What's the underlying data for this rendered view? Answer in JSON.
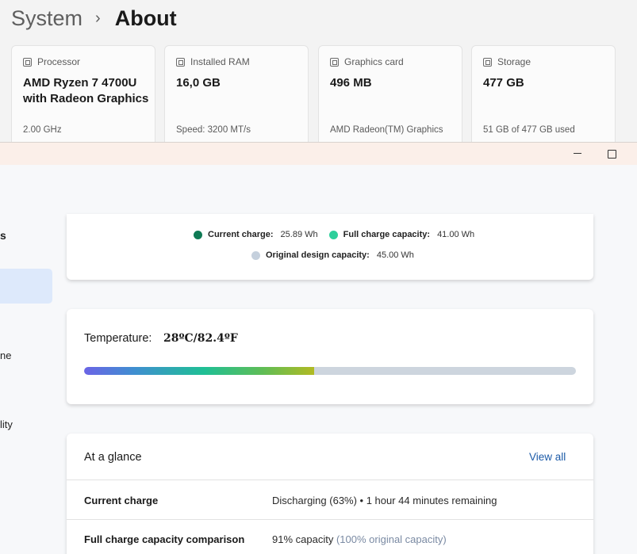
{
  "about_window": {
    "breadcrumb": {
      "parent": "System",
      "separator": "›",
      "current": "About"
    },
    "specs": [
      {
        "icon": "processor-icon",
        "label": "Processor",
        "value": "AMD Ryzen 7 4700U with Radeon Graphics",
        "sub": "2.00 GHz"
      },
      {
        "icon": "ram-icon",
        "label": "Installed RAM",
        "value": "16,0 GB",
        "sub": "Speed: 3200 MT/s"
      },
      {
        "icon": "graphics-card-icon",
        "label": "Graphics card",
        "value": "496 MB",
        "sub": "AMD Radeon(TM) Graphics"
      },
      {
        "icon": "storage-icon",
        "label": "Storage",
        "value": "477 GB",
        "sub": "51 GB of 477 GB used"
      }
    ]
  },
  "battery_window": {
    "controls": {
      "minimize": "minimize-icon",
      "maximize": "maximize-icon"
    },
    "nav_fragments": [
      "s",
      "ne",
      "lity"
    ],
    "legend": [
      {
        "label": "Current charge:",
        "value": "25.89 Wh",
        "color": "#0f7a55"
      },
      {
        "label": "Full charge capacity:",
        "value": "41.00 Wh",
        "color": "#2dcf9b"
      },
      {
        "label": "Original design capacity:",
        "value": "45.00 Wh",
        "color": "#c5d0dd"
      }
    ],
    "temperature": {
      "label": "Temperature:",
      "value": "28ºC/82.4ºF",
      "level_percent": 46.7
    },
    "glance": {
      "title": "At a glance",
      "view_all": "View all",
      "rows": [
        {
          "label": "Current charge",
          "value": "Discharging (63%) • 1 hour 44 minutes remaining",
          "extra": ""
        },
        {
          "label": "Full charge capacity comparison",
          "value": "91% capacity",
          "extra": "(100% original capacity)"
        }
      ]
    }
  }
}
